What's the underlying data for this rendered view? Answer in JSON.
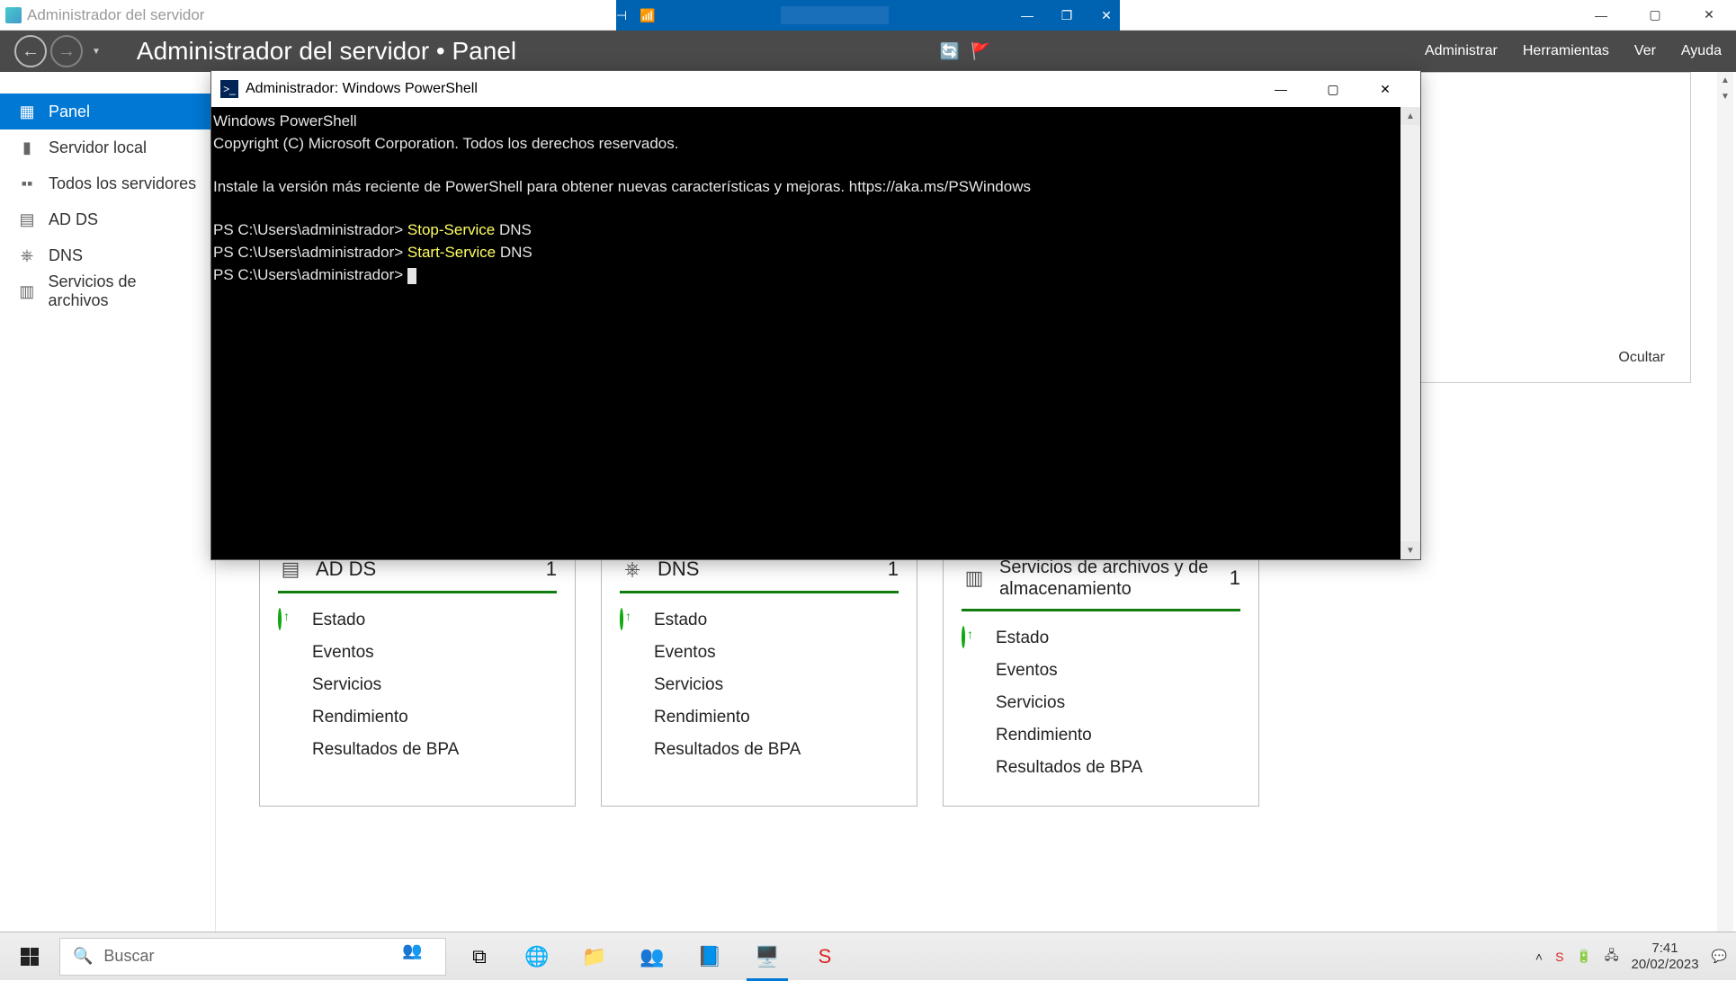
{
  "outer_window": {
    "title": "Administrador del servidor"
  },
  "sm_header": {
    "breadcrumb": "Administrador del servidor • Panel",
    "menu": {
      "admin": "Administrar",
      "tools": "Herramientas",
      "view": "Ver",
      "help": "Ayuda"
    }
  },
  "sidebar": {
    "items": [
      {
        "icon": "dashboard-icon",
        "label": "Panel",
        "active": true
      },
      {
        "icon": "local-server-icon",
        "label": "Servidor local"
      },
      {
        "icon": "all-servers-icon",
        "label": "Todos los servidores"
      },
      {
        "icon": "adds-icon",
        "label": "AD DS"
      },
      {
        "icon": "dns-icon",
        "label": "DNS"
      },
      {
        "icon": "file-services-icon",
        "label": "Servicios de archivos"
      }
    ]
  },
  "panel": {
    "ocultar": "Ocultar"
  },
  "tiles": [
    {
      "icon": "adds-tile-icon",
      "title": "AD DS",
      "count": "1",
      "lines": [
        "Estado",
        "Eventos",
        "Servicios",
        "Rendimiento",
        "Resultados de BPA"
      ]
    },
    {
      "icon": "dns-tile-icon",
      "title": "DNS",
      "count": "1",
      "lines": [
        "Estado",
        "Eventos",
        "Servicios",
        "Rendimiento",
        "Resultados de BPA"
      ]
    },
    {
      "icon": "files-tile-icon",
      "title": "Servicios de archivos y de almacenamiento",
      "count": "1",
      "lines": [
        "Estado",
        "Eventos",
        "Servicios",
        "Rendimiento",
        "Resultados de BPA"
      ]
    }
  ],
  "powershell": {
    "title": "Administrador: Windows PowerShell",
    "banner1": "Windows PowerShell",
    "banner2": "Copyright (C) Microsoft Corporation. Todos los derechos reservados.",
    "install": "Instale la versión más reciente de PowerShell para obtener nuevas características y mejoras. https://aka.ms/PSWindows",
    "prompt": "PS C:\\Users\\administrador> ",
    "cmd1": "Stop-Service",
    "arg1": " DNS",
    "cmd2": "Start-Service",
    "arg2": " DNS"
  },
  "taskbar": {
    "search_placeholder": "Buscar",
    "time": "7:41",
    "date": "20/02/2023"
  }
}
